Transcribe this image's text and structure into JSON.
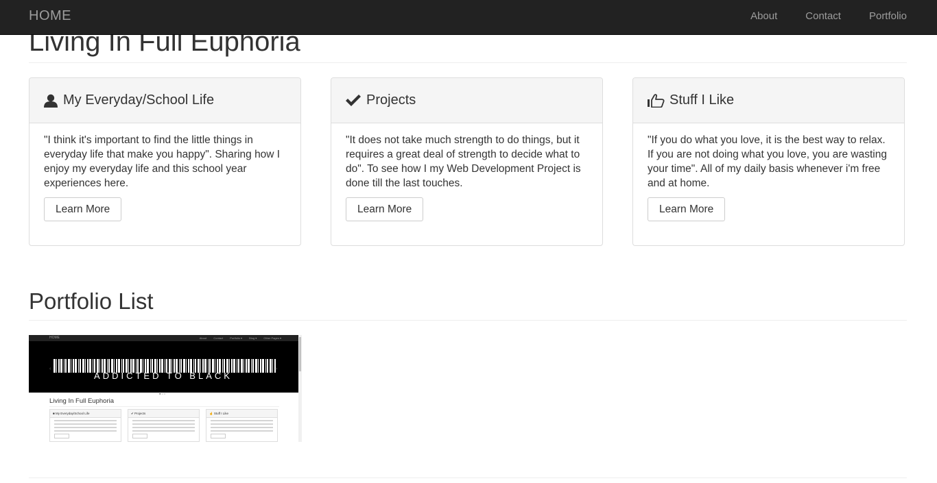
{
  "nav": {
    "brand": "HOME",
    "links": [
      "About",
      "Contact",
      "Portfolio"
    ]
  },
  "page_title": "Living In Full Euphoria",
  "panels": [
    {
      "icon": "user-icon",
      "title": "My Everyday/School Life",
      "body": "\"I think it's important to find the little things in everyday life that make you happy\". Sharing how I enjoy my everyday life and this school year experiences here.",
      "button": "Learn More"
    },
    {
      "icon": "checkmark-icon",
      "title": "Projects",
      "body": "\"It does not take much strength to do things, but it requires a great deal of strength to decide what to do\". To see how I my Web Development Project is done till the last touches.",
      "button": "Learn More"
    },
    {
      "icon": "thumbs-up-icon",
      "title": "Stuff I Like",
      "body": "\"If you do what you love, it is the best way to relax. If you are not doing what you love, you are wasting your time\". All of my daily basis whenever i'm free and at home.",
      "button": "Learn More"
    }
  ],
  "portfolio": {
    "title": "Portfolio List",
    "thumbnail": {
      "nav_brand": "HOME",
      "nav_links": [
        "About",
        "Contact",
        "Portfolio ▾",
        "Blog ▾",
        "Other Pages ▾"
      ],
      "hero_text": "ADDICTED TO BLACK",
      "title": "Living In Full Euphoria",
      "panels": [
        "My Everyday/School Life",
        "Projects",
        "Stuff I Like"
      ]
    }
  }
}
